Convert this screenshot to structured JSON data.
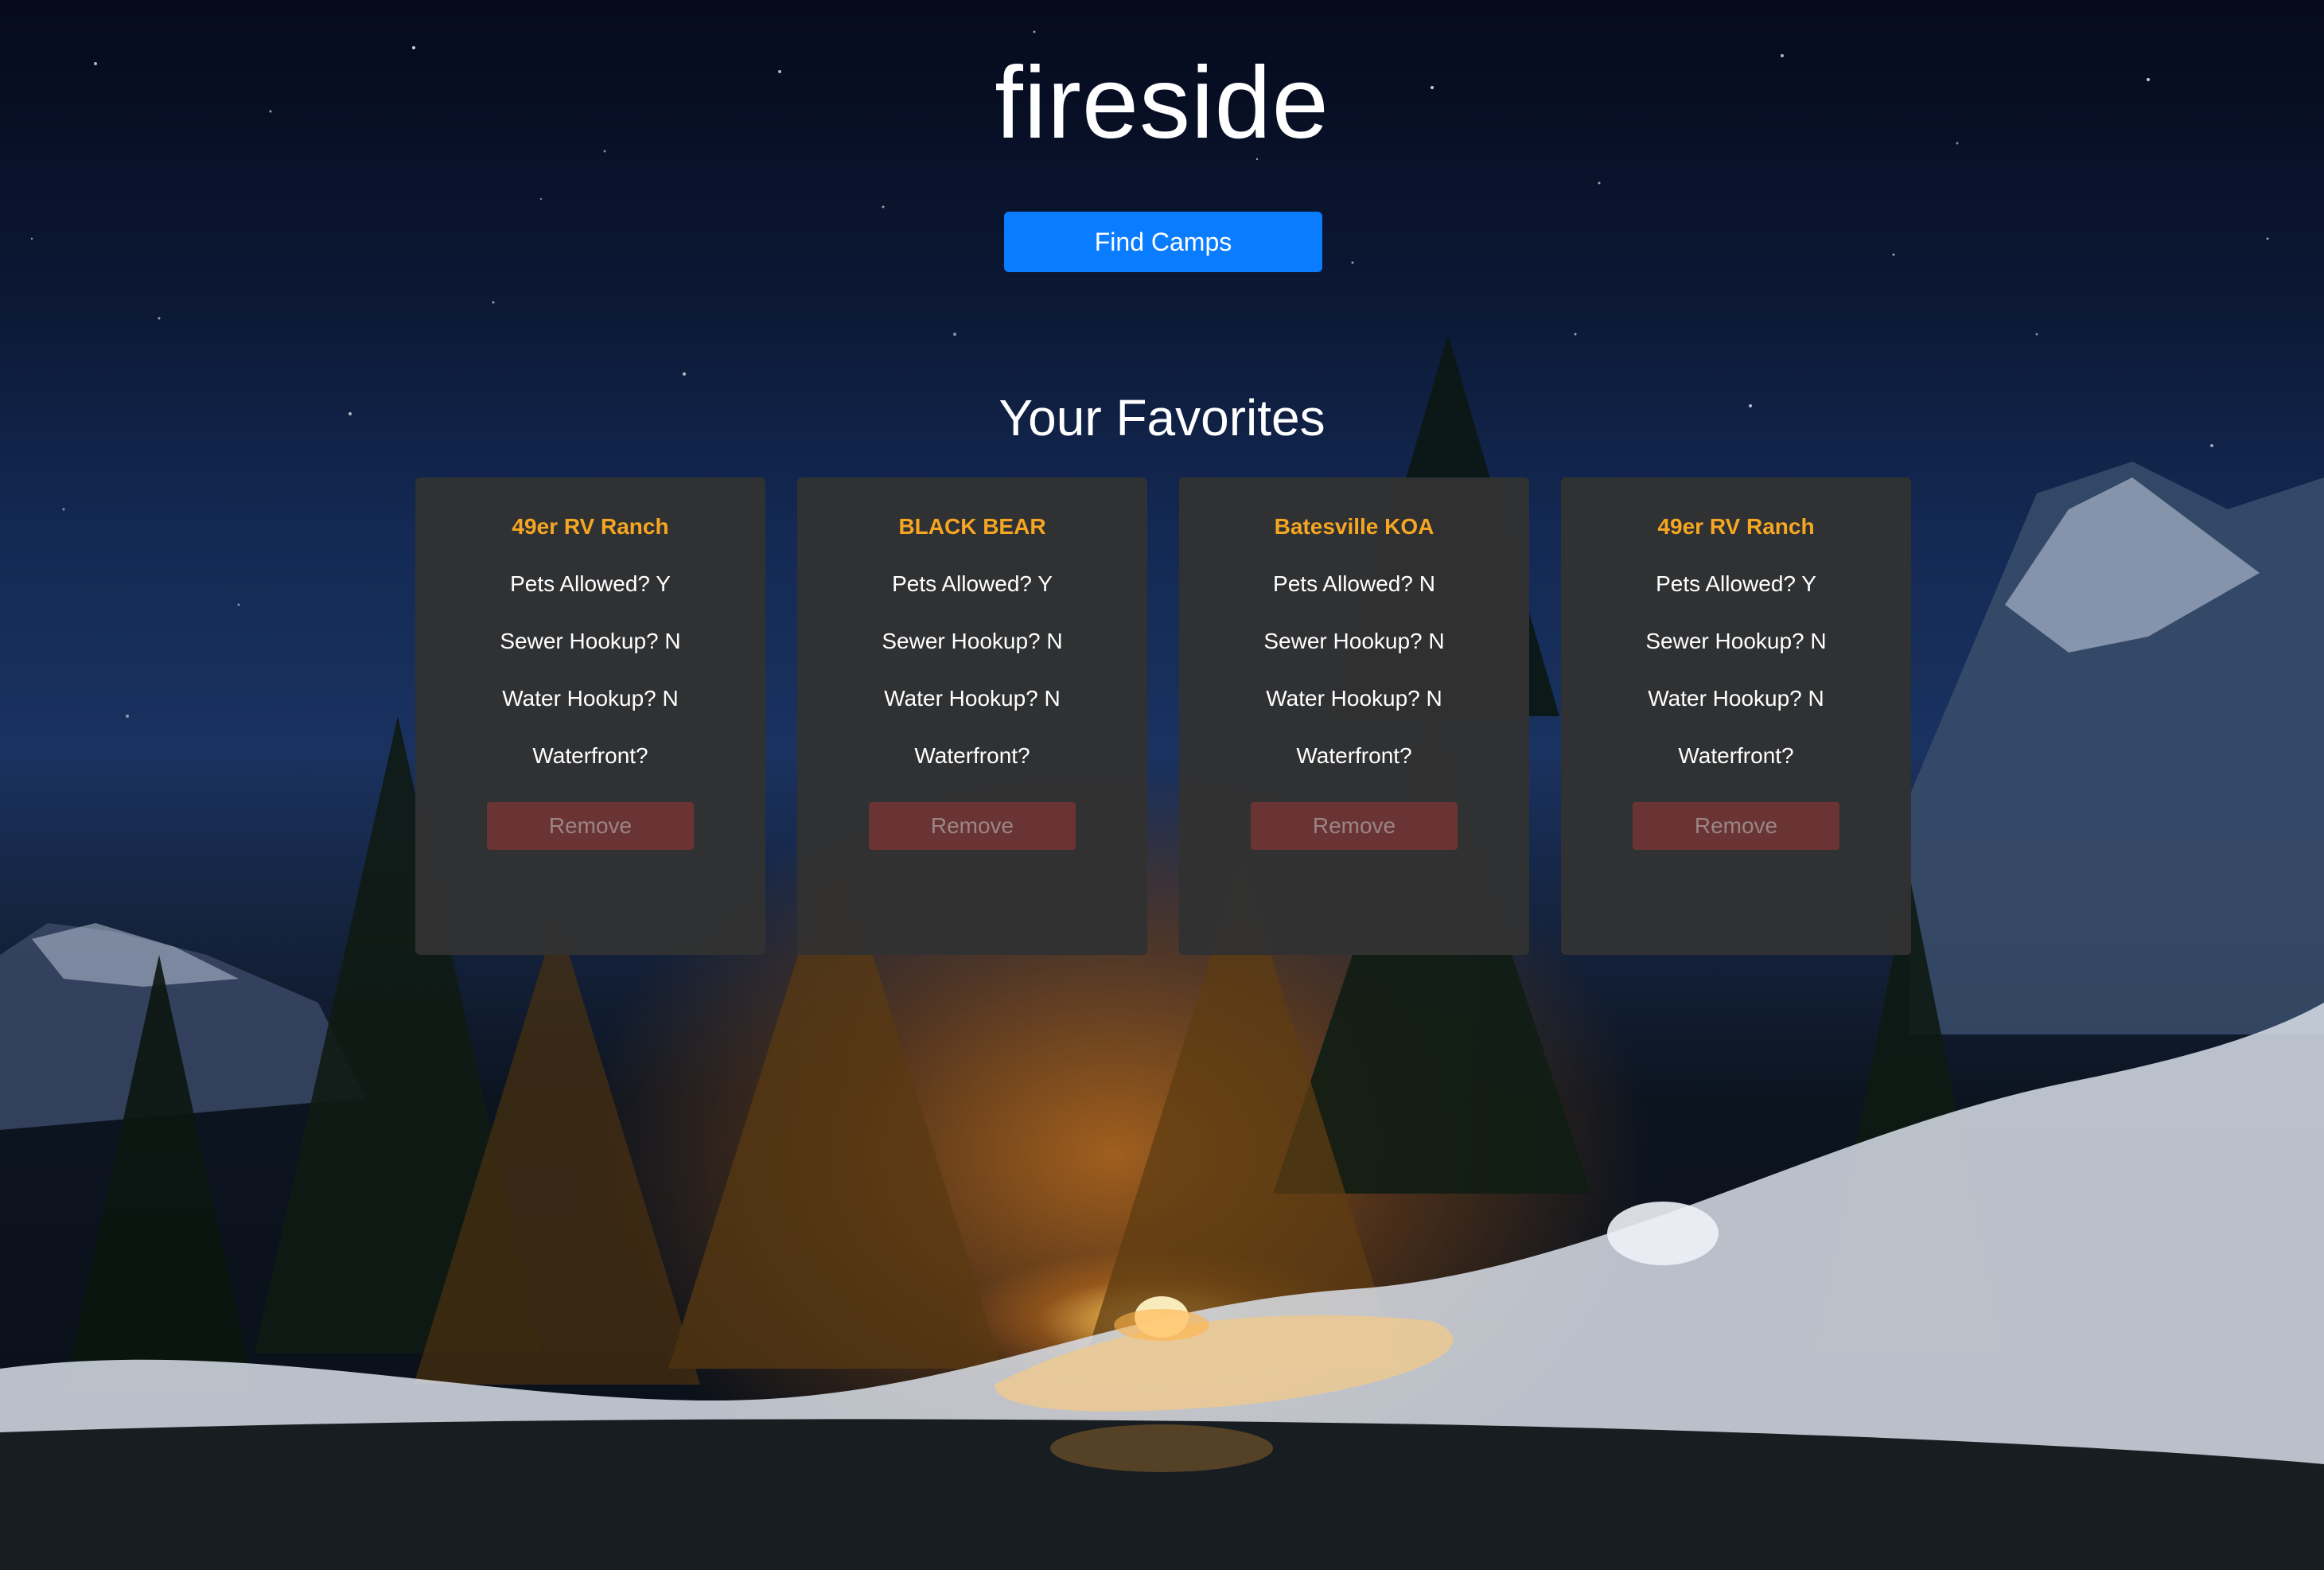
{
  "app": {
    "title": "fireside"
  },
  "actions": {
    "find_label": "Find Camps"
  },
  "favorites": {
    "heading": "Your Favorites",
    "remove_label": "Remove",
    "cards": [
      {
        "name": "49er RV Ranch",
        "pets": "Pets Allowed? Y",
        "sewer": "Sewer Hookup? N",
        "water": "Water Hookup? N",
        "waterfront": "Waterfront?"
      },
      {
        "name": "BLACK BEAR",
        "pets": "Pets Allowed? Y",
        "sewer": "Sewer Hookup? N",
        "water": "Water Hookup? N",
        "waterfront": "Waterfront?"
      },
      {
        "name": "Batesville KOA",
        "pets": "Pets Allowed? N",
        "sewer": "Sewer Hookup? N",
        "water": "Water Hookup? N",
        "waterfront": "Waterfront?"
      },
      {
        "name": "49er RV Ranch",
        "pets": "Pets Allowed? Y",
        "sewer": "Sewer Hookup? N",
        "water": "Water Hookup? N",
        "waterfront": "Waterfront?"
      }
    ]
  },
  "colors": {
    "primary_button": "#0a7cff",
    "card_background": "#323232",
    "camp_name": "#f5a623",
    "remove_button": "#6b3434"
  }
}
